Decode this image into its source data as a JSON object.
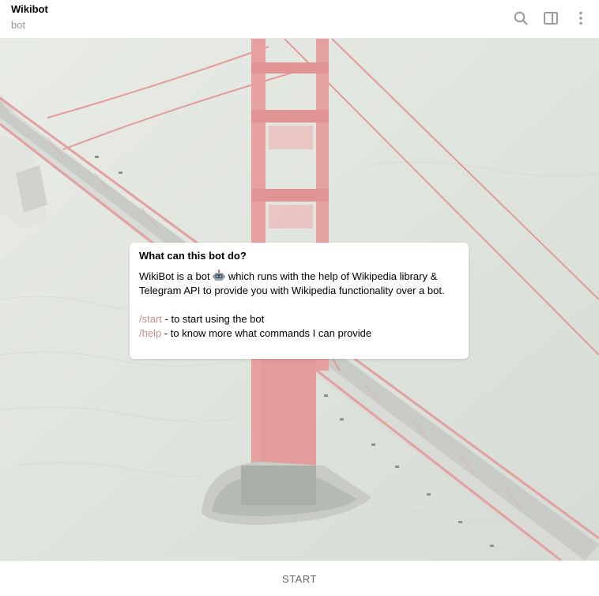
{
  "header": {
    "title": "Wikibot",
    "subtitle": "bot",
    "icons": [
      "search-icon",
      "sidebar-toggle-icon",
      "more-vertical-icon"
    ]
  },
  "info": {
    "title": "What can this bot do?",
    "desc_before_emoji": "WikiBot is a bot ",
    "emoji": "robot-emoji",
    "desc_after_emoji": " which runs with the help of Wikipedia library & Telegram API to provide you with Wikipedia functionality over a bot.",
    "commands": [
      {
        "command": "/start",
        "description": " - to start using the bot"
      },
      {
        "command": "/help",
        "description": " - to know more what commands I can provide"
      }
    ]
  },
  "footer": {
    "start_label": "START"
  },
  "colors": {
    "command_link": "#c98b8b",
    "bridge_red": "#e08a8a"
  }
}
